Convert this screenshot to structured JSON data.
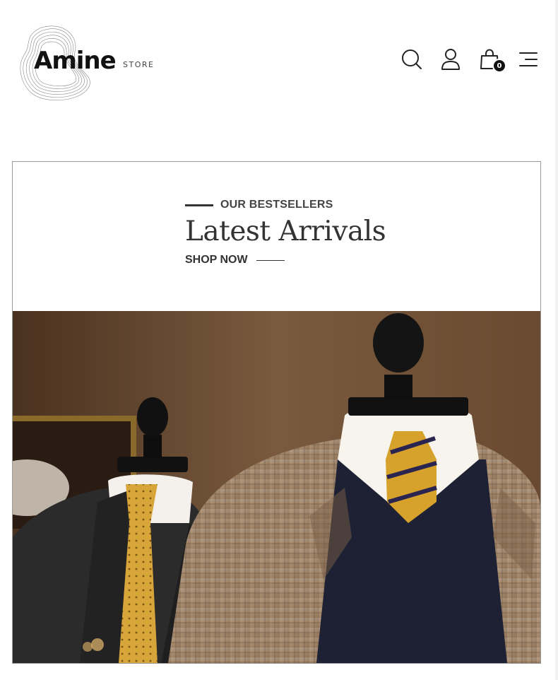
{
  "brand": {
    "name": "Amine",
    "suffix": "STORE"
  },
  "header": {
    "icons": [
      "search-icon",
      "user-icon",
      "bag-icon",
      "menu-icon"
    ],
    "cart_count": "0"
  },
  "promo": {
    "eyebrow": "OUR BESTSELLERS",
    "title": "Latest Arrivals",
    "cta": "SHOP NOW"
  },
  "colors": {
    "text_dark": "#333333",
    "border": "#9a9a9a",
    "badge": "#111111",
    "photo_wall": "#6b4a30",
    "tie_gold": "#d6a22b",
    "sweater_navy": "#1e2133"
  }
}
